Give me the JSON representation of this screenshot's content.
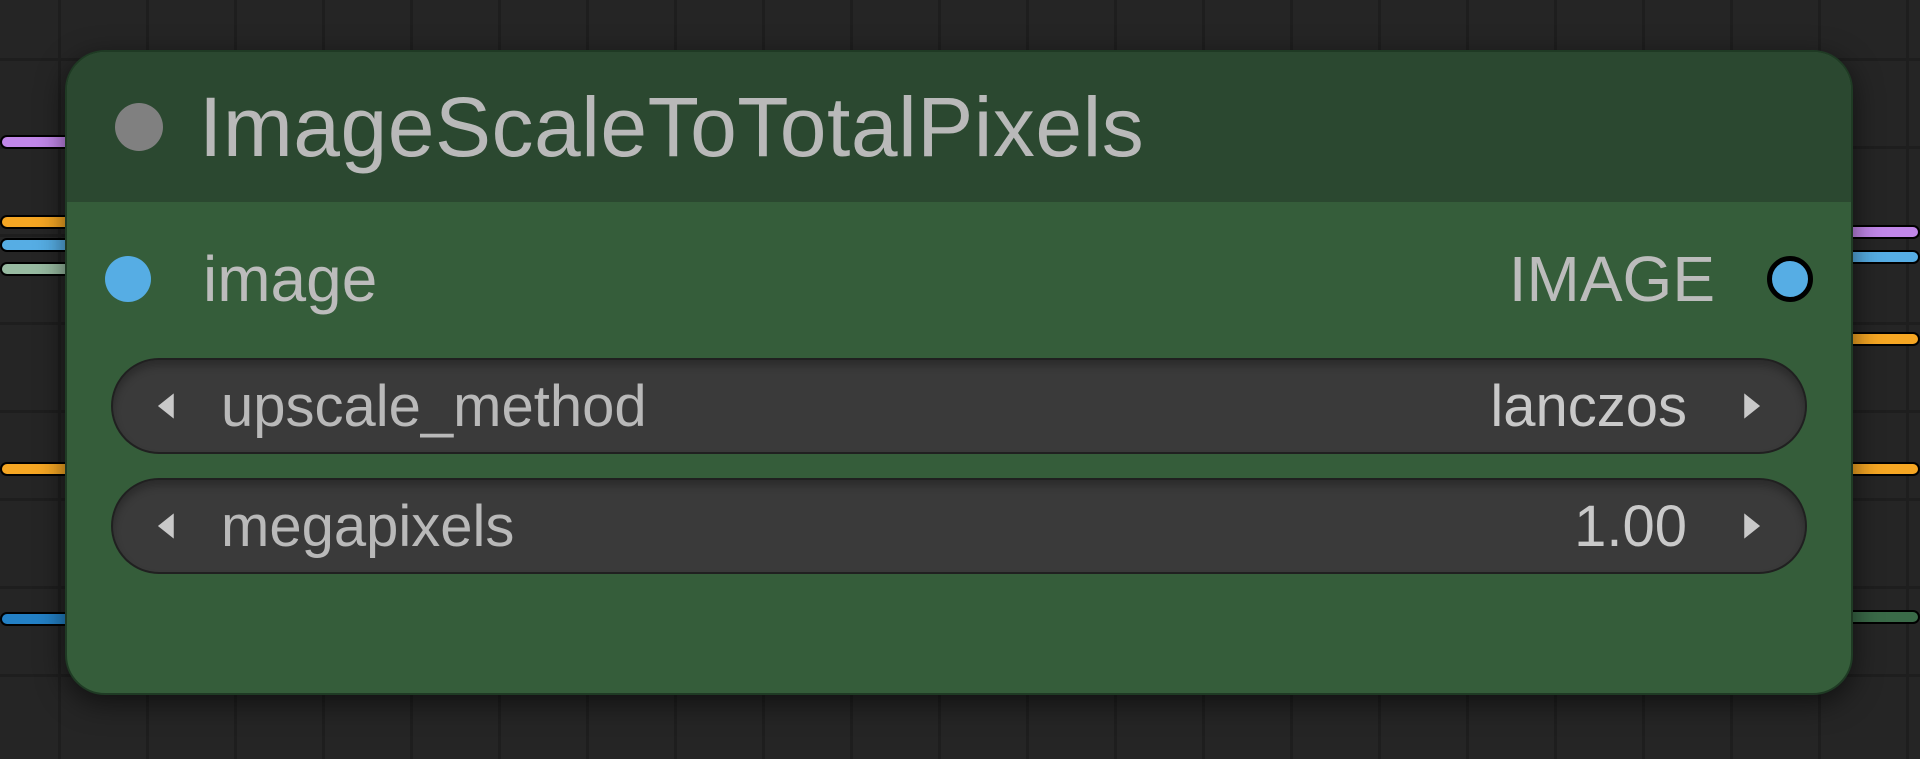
{
  "node": {
    "title": "ImageScaleToTotalPixels",
    "inputs": [
      {
        "label": "image"
      }
    ],
    "outputs": [
      {
        "label": "IMAGE"
      }
    ],
    "params": [
      {
        "name": "upscale_method",
        "value": "lanczos"
      },
      {
        "name": "megapixels",
        "value": "1.00"
      }
    ]
  }
}
